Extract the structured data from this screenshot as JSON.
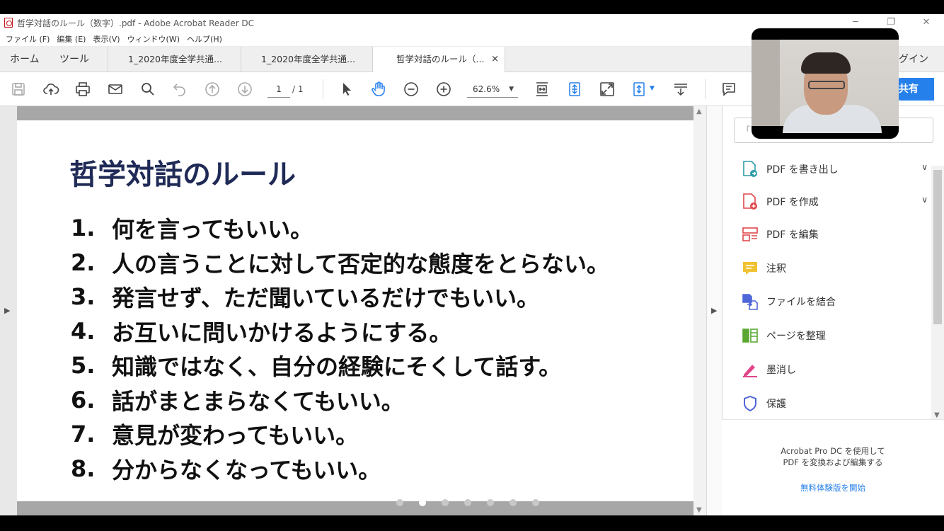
{
  "window": {
    "title": "哲学対話のルール（数字）.pdf - Adobe Acrobat Reader DC",
    "controls": [
      "─",
      "❐",
      "✕"
    ]
  },
  "menu": [
    "ファイル (F)",
    "編集 (E)",
    "表示(V)",
    "ウィンドウ(W)",
    "ヘルプ(H)"
  ],
  "tabs": {
    "home": "ホーム",
    "tools": "ツール",
    "docs": [
      "1_2020年度全学共通...",
      "1_2020年度全学共通...",
      "哲学対話のルール（..."
    ],
    "close": "×",
    "login": "グイン"
  },
  "toolbar": {
    "page_current": "1",
    "page_total": "/ 1",
    "zoom": "62.6%",
    "zoom_arrow": "▼",
    "share": "共有"
  },
  "slide": {
    "title": "哲学対話のルール",
    "rules": [
      {
        "num": "1.",
        "text": "何を言ってもいい。"
      },
      {
        "num": "2.",
        "text": "人の言うことに対して否定的な態度をとらない。"
      },
      {
        "num": "3.",
        "text": "発言せず、ただ聞いているだけでもいい。"
      },
      {
        "num": "4.",
        "text": "お互いに問いかけるようにする。"
      },
      {
        "num": "5.",
        "text": "知識ではなく、自分の経験にそくして話す。"
      },
      {
        "num": "6.",
        "text": "話がまとまらなくてもいい。"
      },
      {
        "num": "7.",
        "text": "意見が変わってもいい。"
      },
      {
        "num": "8.",
        "text": "分からなくなってもいい。"
      }
    ]
  },
  "arrows": {
    "left": "▶",
    "up": "▲",
    "down": "▼",
    "chev": "∨"
  },
  "right_panel": {
    "search_placeholder": "「",
    "tools": [
      {
        "label": "PDF を書き出し",
        "icon": "export-pdf-icon",
        "color": "#2b9ba8",
        "expand": true
      },
      {
        "label": "PDF を作成",
        "icon": "create-pdf-icon",
        "color": "#e0474c",
        "expand": true
      },
      {
        "label": "PDF を編集",
        "icon": "edit-pdf-icon",
        "color": "#e0474c",
        "expand": false
      },
      {
        "label": "注釈",
        "icon": "comment-icon",
        "color": "#f1c232",
        "expand": false
      },
      {
        "label": "ファイルを結合",
        "icon": "combine-files-icon",
        "color": "#4f66d8",
        "expand": false
      },
      {
        "label": "ページを整理",
        "icon": "organize-pages-icon",
        "color": "#5aa832",
        "expand": false
      },
      {
        "label": "墨消し",
        "icon": "redact-icon",
        "color": "#e0478a",
        "expand": false
      },
      {
        "label": "保護",
        "icon": "protect-icon",
        "color": "#4f66d8",
        "expand": false
      }
    ],
    "promo_line1": "Acrobat Pro DC を使用して",
    "promo_line2": "PDF を変換および編集する",
    "promo_link": "無料体験版を開始"
  }
}
